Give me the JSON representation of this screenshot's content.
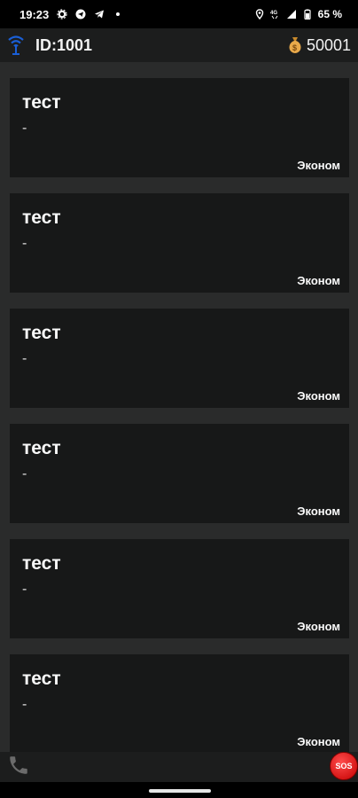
{
  "status_bar": {
    "time": "19:23",
    "battery": "65 %",
    "network": "4G",
    "icons_left": [
      "settings-icon",
      "telegram-circle-icon",
      "telegram-icon",
      "dot-icon"
    ],
    "icons_right": [
      "location-icon",
      "network-icon",
      "signal-icon",
      "battery-icon"
    ]
  },
  "app_bar": {
    "driver_id": "ID:1001",
    "balance": "50001",
    "signal_icon": "wifi-signal-icon",
    "balance_icon": "moneybag-icon"
  },
  "orders": [
    {
      "title": "тест",
      "subtitle": "-",
      "tariff": "Эконом"
    },
    {
      "title": "тест",
      "subtitle": "-",
      "tariff": "Эконом"
    },
    {
      "title": "тест",
      "subtitle": "-",
      "tariff": "Эконом"
    },
    {
      "title": "тест",
      "subtitle": "-",
      "tariff": "Эконом"
    },
    {
      "title": "тест",
      "subtitle": "-",
      "tariff": "Эконом"
    },
    {
      "title": "тест",
      "subtitle": "-",
      "tariff": "Эконом"
    }
  ],
  "bottom_bar": {
    "phone_icon": "phone-icon",
    "sos_label": "SOS"
  },
  "colors": {
    "app_bar_bg": "#1c1d1d",
    "list_bg": "#2a2b2b",
    "card_bg": "#171818",
    "sos_red": "#e00000"
  }
}
